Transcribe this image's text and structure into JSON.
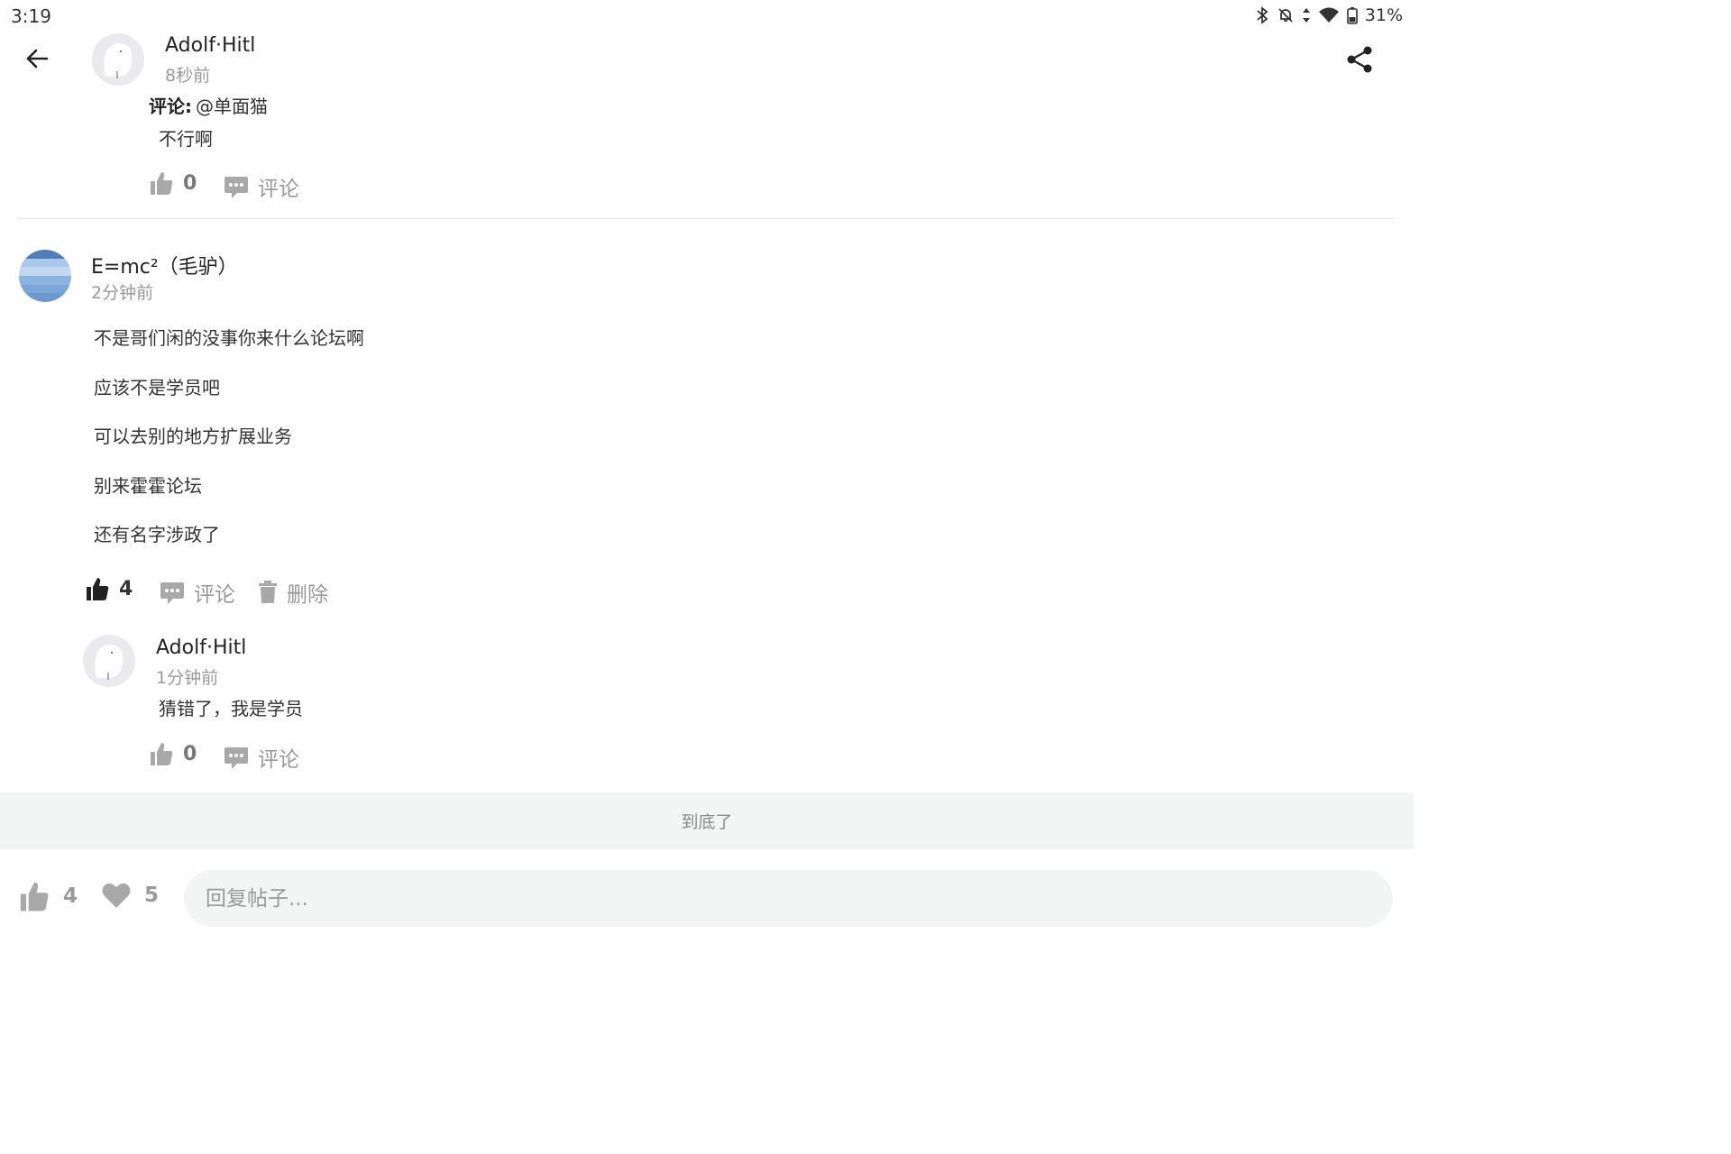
{
  "status_bar": {
    "time": "3:19",
    "battery": "31%"
  },
  "first_comment": {
    "username": "Adolf·Hitl",
    "time": "8秒前",
    "reply_prefix": "评论:",
    "reply_target": "@单面猫",
    "text": "不行啊",
    "like_count": "0",
    "comment_label": "评论"
  },
  "main_post": {
    "username": "E=mc²（毛驴）",
    "time": "2分钟前",
    "lines": [
      "不是哥们闲的没事你来什么论坛啊",
      "应该不是学员吧",
      "可以去别的地方扩展业务",
      "别来霍霍论坛",
      "还有名字涉政了"
    ],
    "like_count": "4",
    "comment_label": "评论",
    "delete_label": "删除"
  },
  "reply": {
    "username": "Adolf·Hitl",
    "time": "1分钟前",
    "text": "猜错了，我是学员",
    "like_count": "0",
    "comment_label": "评论"
  },
  "end_label": "到底了",
  "bottom_bar": {
    "like_count": "4",
    "favorite_count": "5",
    "reply_placeholder": "回复帖子..."
  },
  "icons": {
    "back": "arrow-left-icon",
    "share": "share-icon",
    "like": "thumbs-up-icon",
    "comment": "comment-icon",
    "delete": "trash-icon",
    "favorite": "heart-icon"
  },
  "colors": {
    "muted_text": "#999999",
    "band_bg": "#f3f5f4",
    "liked": "#222222",
    "avatar_blue": "#5b8fc8"
  }
}
